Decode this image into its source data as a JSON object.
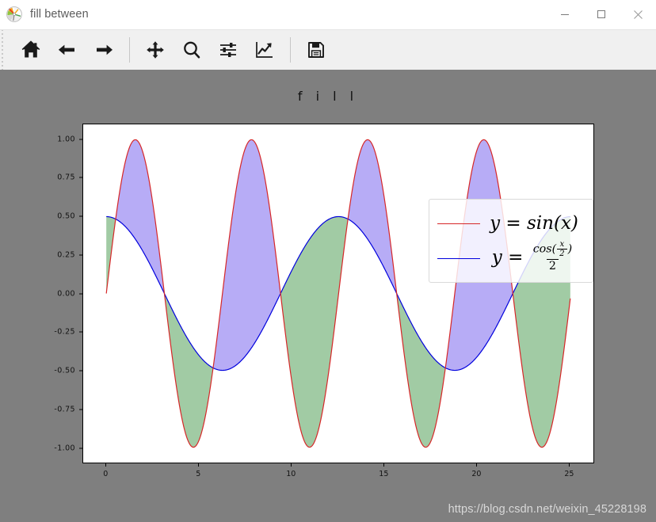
{
  "window": {
    "title": "fill between",
    "app_icon": "matplotlib-logo-icon",
    "minimize_label": "—",
    "maximize_label": "☐",
    "close_label": "✕"
  },
  "toolbar": {
    "items": [
      {
        "name": "home-button",
        "label": "Home",
        "icon": "home-icon"
      },
      {
        "name": "back-button",
        "label": "Back",
        "icon": "arrow-left-icon"
      },
      {
        "name": "forward-button",
        "label": "Forward",
        "icon": "arrow-right-icon"
      },
      {
        "name": "pan-button",
        "label": "Pan",
        "icon": "move-arrows-icon"
      },
      {
        "name": "zoom-button",
        "label": "Zoom to rectangle",
        "icon": "magnifier-icon"
      },
      {
        "name": "configure-subplots-button",
        "label": "Configure subplots",
        "icon": "sliders-icon"
      },
      {
        "name": "edit-axis-button",
        "label": "Edit axis, curve and image parameters",
        "icon": "chart-line-icon"
      },
      {
        "name": "save-button",
        "label": "Save the figure",
        "icon": "floppy-disk-icon"
      }
    ]
  },
  "figure": {
    "background_color": "#7f7f7f",
    "axes_background_color": "#ffffff",
    "watermark": "https://blog.csdn.net/weixin_45228198"
  },
  "legend": {
    "entries": [
      {
        "name": "legend-entry-sine",
        "color": "#d62728",
        "y": "y",
        "eq": "=",
        "fn": "sin",
        "arg": "(x)"
      },
      {
        "name": "legend-entry-cosine",
        "color": "#0000dd",
        "y": "y",
        "eq": "=",
        "num_fn": "cos",
        "num_arg_top": "x",
        "num_arg_bot": "2",
        "den": "2"
      }
    ]
  },
  "chart_data": {
    "type": "area",
    "title": "f i l l",
    "title_raw": "fill",
    "xlabel": "",
    "ylabel": "",
    "xlim": [
      -1.25,
      26.35
    ],
    "ylim": [
      -1.1,
      1.1
    ],
    "grid": false,
    "legend_position": "upper right",
    "xticks": [
      0,
      5,
      10,
      15,
      20,
      25
    ],
    "xtick_labels": [
      "0",
      "5",
      "10",
      "15",
      "20",
      "25"
    ],
    "yticks": [
      1.0,
      0.75,
      0.5,
      0.25,
      0.0,
      -0.25,
      -0.5,
      -0.75,
      -1.0
    ],
    "ytick_labels": [
      "1.00",
      "0.75",
      "0.50",
      "0.25",
      "0.00",
      "-0.25",
      "-0.50",
      "-0.75",
      "-1.00"
    ],
    "x_domain": [
      0,
      25.1
    ],
    "series": [
      {
        "name": "y = sin(x)",
        "formula": "sin(x)",
        "color": "#d62728",
        "linewidth": 1.2,
        "period": 6.2832,
        "amplitude": 1.0
      },
      {
        "name": "y = cos(x/2)/2",
        "formula": "cos(x/2)/2",
        "color": "#0000dd",
        "linewidth": 1.2,
        "period": 12.5664,
        "amplitude": 0.5
      }
    ],
    "fills": [
      {
        "name": "fill-above",
        "condition": "sin(x) >= cos(x/2)/2",
        "color": "#7b68ee",
        "alpha": 0.55,
        "label": "blue-purple"
      },
      {
        "name": "fill-below",
        "condition": "sin(x) < cos(x/2)/2",
        "color": "#2e8b35",
        "alpha": 0.45,
        "label": "green"
      }
    ]
  }
}
